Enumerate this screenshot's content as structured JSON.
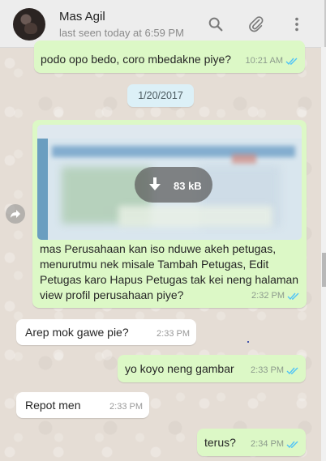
{
  "header": {
    "contact_name": "Mas Agil",
    "last_seen": "last seen today at 6:59 PM",
    "icons": [
      "search-icon",
      "attach-icon",
      "menu-icon"
    ]
  },
  "messages": [
    {
      "id": "m0",
      "direction": "outgoing",
      "text": "podo opo bedo, coro mbedakne piye?",
      "time": "10:21 AM",
      "status": "read"
    },
    {
      "id": "date",
      "type": "date",
      "text": "1/20/2017"
    },
    {
      "id": "m1",
      "direction": "outgoing",
      "type": "image",
      "download_size": "83 kB",
      "caption": "mas Perusahaan kan iso nduwe akeh petugas, menurutmu nek misale Tambah Petugas, Edit Petugas karo Hapus Petugas tak kei neng halaman view profil perusahaan piye?",
      "time": "2:32 PM",
      "status": "read"
    },
    {
      "id": "m2",
      "direction": "incoming",
      "text": "Arep mok gawe pie?",
      "time": "2:33 PM"
    },
    {
      "id": "m3",
      "direction": "outgoing",
      "text": "yo koyo neng gambar",
      "time": "2:33 PM",
      "status": "read"
    },
    {
      "id": "m4",
      "direction": "incoming",
      "text": "Repot men",
      "time": "2:33 PM"
    },
    {
      "id": "m5",
      "direction": "outgoing",
      "text": "terus?",
      "time": "2:34 PM",
      "status": "read"
    }
  ],
  "colors": {
    "outgoing_bubble": "#dcf8c6",
    "incoming_bubble": "#ffffff",
    "read_ticks": "#4fc3f7",
    "date_pill": "#dcf0f7",
    "header_bg": "#ededed"
  }
}
